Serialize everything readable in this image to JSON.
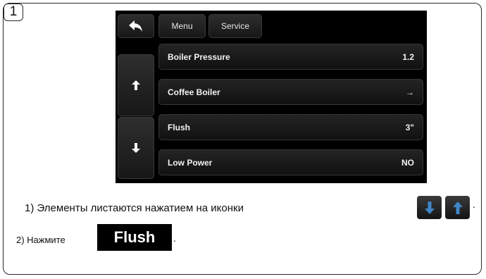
{
  "step_number": "1",
  "screen": {
    "tabs": [
      {
        "label": "Menu"
      },
      {
        "label": "Service"
      }
    ],
    "rows": [
      {
        "label": "Boiler Pressure",
        "value": "1.2"
      },
      {
        "label": "Coffee Boiler",
        "value": "→"
      },
      {
        "label": "Flush",
        "value": "3\""
      },
      {
        "label": "Low Power",
        "value": "NO"
      }
    ]
  },
  "instructions": {
    "line1": "1) Элементы листаются нажатием на иконки",
    "line2": "2) Нажмите",
    "flush_label": "Flush",
    "dot": "."
  },
  "icons": {
    "back": "back-arrow-icon",
    "up": "arrow-up-icon",
    "down": "arrow-down-icon"
  },
  "colors": {
    "arrow_blue": "#3f86c6",
    "screen_bg": "#000000"
  }
}
